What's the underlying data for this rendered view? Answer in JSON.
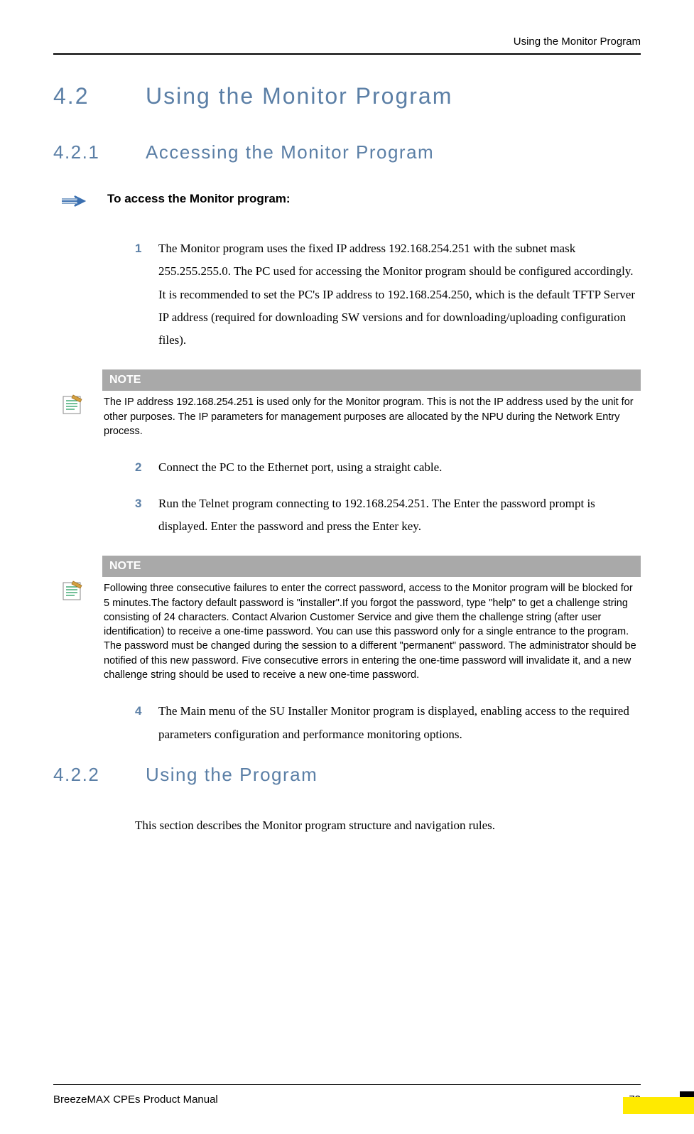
{
  "header": {
    "running_title": "Using the Monitor Program"
  },
  "section": {
    "number": "4.2",
    "title": "Using the Monitor Program"
  },
  "subsection_1": {
    "number": "4.2.1",
    "title": "Accessing the Monitor Program"
  },
  "access_intro": "To access the Monitor program:",
  "steps": {
    "s1_num": "1",
    "s1_text": "The Monitor program uses the fixed IP address 192.168.254.251 with the subnet mask 255.255.255.0. The PC used for accessing the Monitor program should be configured accordingly. It is recommended to set the PC's IP address to 192.168.254.250, which is the default TFTP Server IP address (required for downloading SW versions and for downloading/uploading configuration files).",
    "s2_num": "2",
    "s2_text": "Connect the PC to the Ethernet port, using a straight cable.",
    "s3_num": "3",
    "s3_text": "Run the Telnet program connecting to 192.168.254.251. The Enter the password prompt  is displayed. Enter the password and press the Enter key.",
    "s4_num": "4",
    "s4_text": "The Main menu of the SU Installer Monitor program is displayed, enabling access to the required parameters configuration and performance monitoring options."
  },
  "note1": {
    "label": "NOTE",
    "body": "The IP address 192.168.254.251 is used only for the Monitor program. This is not the IP address used by the unit for other purposes. The IP parameters for management purposes are allocated by the NPU during the Network Entry process."
  },
  "note2": {
    "label": "NOTE",
    "body": "Following three consecutive failures to enter the correct password, access to the Monitor program will be blocked for 5 minutes.The factory default password is \"installer\".If you forgot the password, type \"help\" to get a challenge string consisting of 24 characters. Contact Alvarion Customer Service and give them the challenge string (after user identification) to receive a one-time password. You can use this password only for a single entrance to the program. The password must be changed during the session to a different  \"permanent\" password. The administrator should be notified of this new password. Five consecutive errors in entering the one-time password will invalidate it, and a new challenge string should be used to receive a new one-time password."
  },
  "subsection_2": {
    "number": "4.2.2",
    "title": "Using the Program"
  },
  "body_422": "This section describes the Monitor program structure and navigation rules.",
  "footer": {
    "doc_title": "BreezeMAX CPEs Product Manual",
    "page_number": "73"
  }
}
